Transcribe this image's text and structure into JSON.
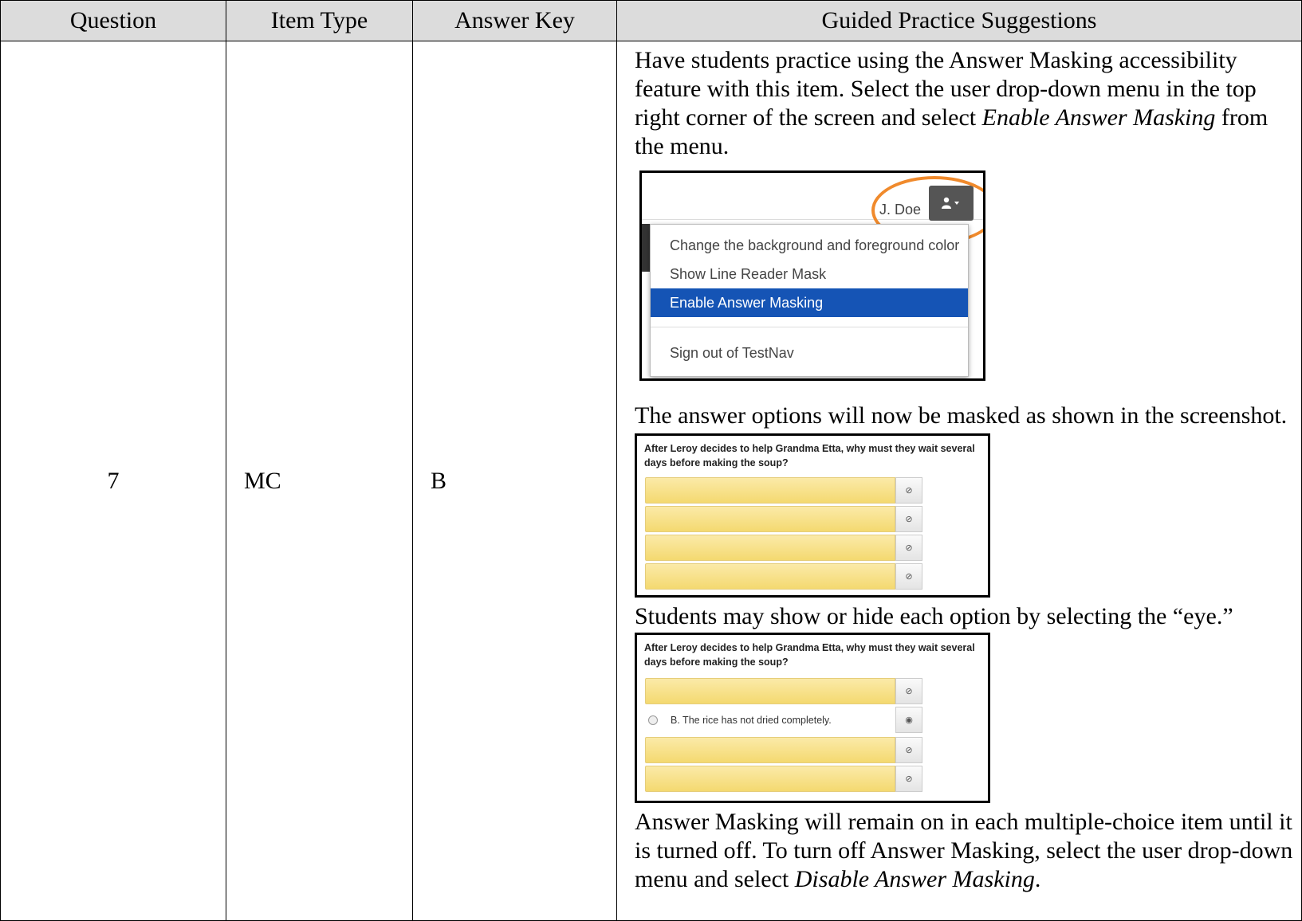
{
  "headers": {
    "question": "Question",
    "item_type": "Item Type",
    "answer_key": "Answer Key",
    "guided": "Guided Practice Suggestions"
  },
  "row": {
    "question": "7",
    "item_type": "MC",
    "answer_key": "B"
  },
  "guided": {
    "p1_a": "Have students practice using the Answer Masking accessibility feature with this item. Select the user drop-down menu in the top right corner of the screen and select ",
    "p1_em": "Enable Answer Masking",
    "p1_b": " from the menu.",
    "p2": "The answer options will now be masked as shown in the screenshot.",
    "p3": "Students may show or hide each option by selecting the “eye.”",
    "p4_a": "Answer Masking will remain on in each multiple-choice item until it is turned off. To turn off Answer Masking, select the user drop-down menu and select ",
    "p4_em": "Disable Answer Masking",
    "p4_b": "."
  },
  "menu_shot": {
    "user_name": "J. Doe",
    "items": [
      "Change the background and foreground color",
      "Show Line Reader Mask",
      "Enable Answer Masking",
      "Sign out of TestNav"
    ],
    "highlight_color": "#1554b5",
    "circle_color": "#f08a2c"
  },
  "mask_shot": {
    "question": "After Leroy decides to help Grandma Etta, why must they wait several days before making the soup?",
    "revealed_option": "B.  The rice has not dried completely.",
    "mask_color": "#f4d970"
  },
  "icons": [
    "user-icon",
    "caret-down-icon",
    "eye-slash-icon",
    "eye-icon"
  ]
}
